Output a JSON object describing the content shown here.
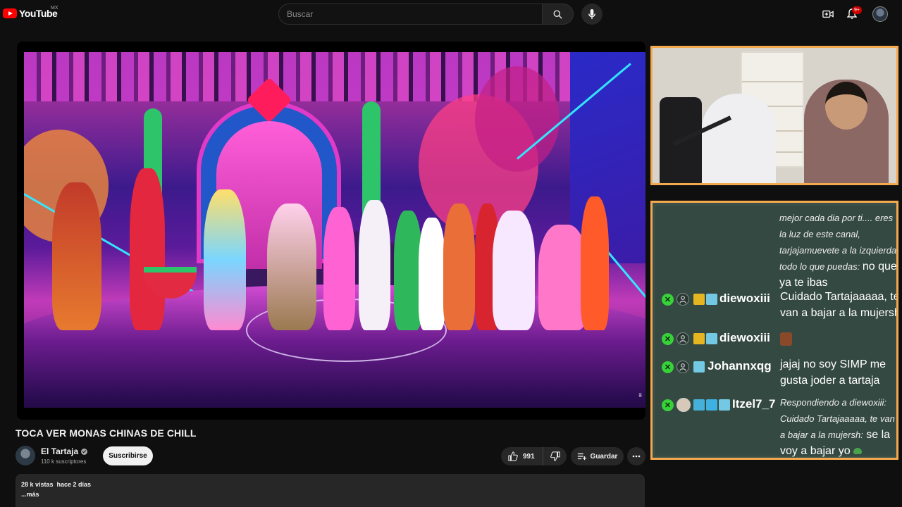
{
  "header": {
    "logo_text": "YouTube",
    "country_code": "MX",
    "search_placeholder": "Buscar",
    "notification_count": "9+"
  },
  "video": {
    "title": "TOCA VER MONAS CHINAS DE CHILL"
  },
  "channel": {
    "name": "El Tartaja",
    "subscribers": "110 k suscriptores",
    "subscribe_label": "Suscribirse"
  },
  "actions": {
    "like_count": "991",
    "save_label": "Guardar"
  },
  "description": {
    "stats": "28 k vistas  hace 2 días",
    "more_label": "...más"
  },
  "chat": {
    "top_message": "mejor cada dia por ti.... eres la luz de este canal, tarjajamuevete a la izquierda todo lo que puedas:",
    "top_reply": "no que ya te ibas",
    "messages": [
      {
        "username": "diewoxiii",
        "text": "Cuidado Tartajaaaaa, te van a bajar a la mujersh"
      },
      {
        "username": "diewoxiii",
        "text": ""
      },
      {
        "username": "Johannxqg",
        "text": "jajaj no soy SIMP me gusta joder a tartaja"
      },
      {
        "username": "Itzel7_7",
        "reply_to": "Respondiendo a diewoxiii: Cuidado Tartajaaaaa, te van a bajar a la mujersh:",
        "text": "se la voy a bajar yo"
      }
    ]
  },
  "colors": {
    "overlay_border": "#f5a94e",
    "chat_bg": "#354943",
    "yt_red": "#ff0000"
  }
}
